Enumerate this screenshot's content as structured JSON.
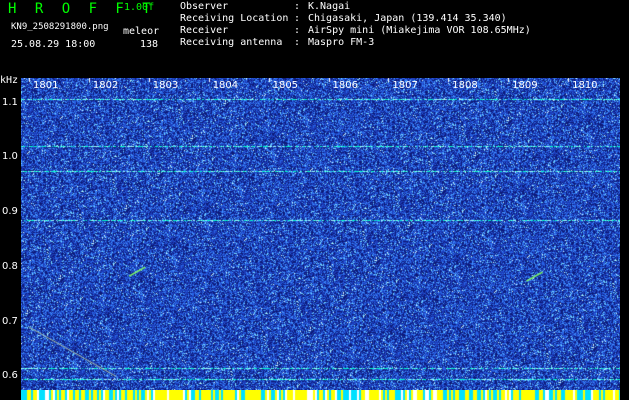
{
  "header": {
    "app_title": "H R O F F T",
    "version": "1.00f",
    "filename": "KN9_2508291800.png",
    "ident": "meleor",
    "datetime": "25.08.29 18:00",
    "count": "138"
  },
  "meta": [
    {
      "key": "Observer",
      "value": "K.Nagai"
    },
    {
      "key": "Receiving Location",
      "value": "Chigasaki, Japan (139.414 35.340)"
    },
    {
      "key": "Receiver",
      "value": "AirSpy mini (Miakejima VOR 108.65MHz)"
    },
    {
      "key": "Receiving antenna",
      "value": "Maspro FM-3"
    }
  ],
  "meta_separator": ":",
  "chart_data": {
    "type": "heatmap",
    "ylabel": "kHz",
    "x_ticks": [
      "1801",
      "1802",
      "1803",
      "1804",
      "1805",
      "1806",
      "1807",
      "1808",
      "1809",
      "1810"
    ],
    "y_ticks": [
      0.6,
      0.7,
      0.8,
      0.9,
      1.0,
      1.1
    ],
    "y_tick_labels": [
      "0.6",
      "0.7",
      "0.8",
      "0.9",
      "1.0",
      "1.1"
    ],
    "ylim": [
      0.575,
      1.145
    ],
    "horizontal_signals_khz": [
      1.107,
      1.02,
      0.975,
      0.885,
      0.615,
      0.595
    ],
    "meteor_echoes": [
      {
        "x_min": 1802.7,
        "y_khz": 0.792
      },
      {
        "x_min": 1809.2,
        "y_khz": 0.783
      }
    ],
    "colors": {
      "background": "#1c3cb8",
      "noise_low": "#0a1a80",
      "noise_high": "#3a8cff",
      "signal": "#00ffcc",
      "strip_yellow": "#ffff00",
      "strip_cyan": "#00e0ff"
    }
  }
}
